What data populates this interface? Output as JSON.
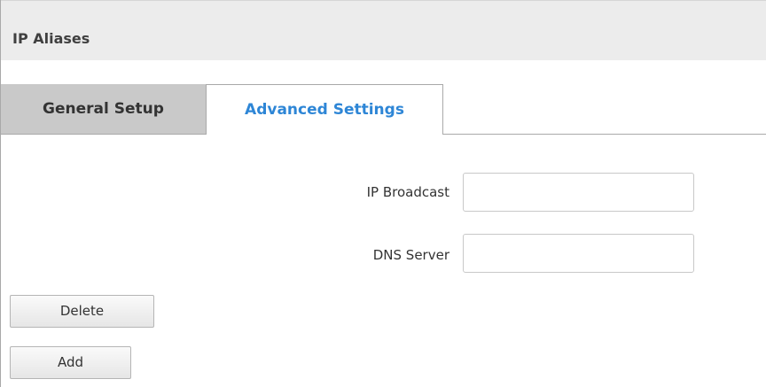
{
  "section": {
    "title": "IP Aliases"
  },
  "tabs": [
    {
      "label": "General Setup",
      "active": false
    },
    {
      "label": "Advanced Settings",
      "active": true
    }
  ],
  "form": {
    "ip_broadcast": {
      "label": "IP Broadcast",
      "value": "",
      "placeholder": ""
    },
    "dns_server": {
      "label": "DNS Server",
      "value": "",
      "placeholder": ""
    }
  },
  "buttons": {
    "delete_label": "Delete",
    "add_label": "Add"
  },
  "colors": {
    "active_tab_text": "#2e86d6",
    "inactive_tab_bg": "#c9c9c9",
    "header_bg": "#ececec"
  }
}
